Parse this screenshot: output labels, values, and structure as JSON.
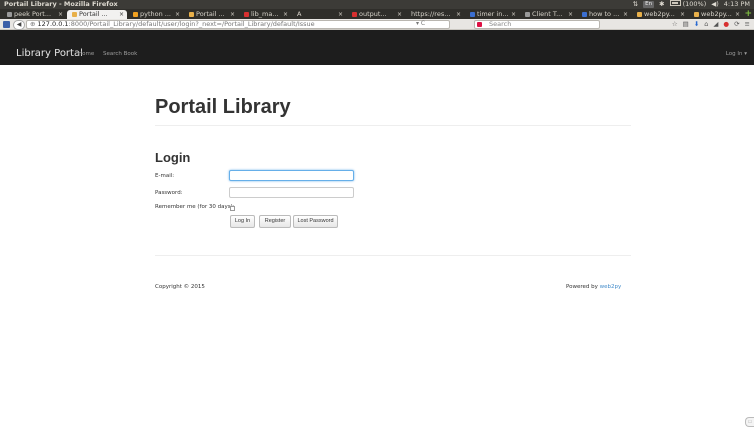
{
  "window": {
    "title": "Portail Library - Mozilla Firefox",
    "tray": {
      "keyboard": "En",
      "battery": "(100%)",
      "volume": "◀)",
      "time": "4:13 PM"
    }
  },
  "tabs": [
    {
      "label": "peek Port...",
      "icon_color": "#9a9a9a",
      "active": false
    },
    {
      "label": "Portail ...",
      "icon_color": "#e8b04a",
      "active": true
    },
    {
      "label": "python ...",
      "icon_color": "#f0a020",
      "active": false
    },
    {
      "label": "Portail ...",
      "icon_color": "#e8b04a",
      "active": false
    },
    {
      "label": "lib_ma...",
      "icon_color": "#d83030",
      "active": false
    },
    {
      "label": "A",
      "icon_color": "#cccccc",
      "active": false
    },
    {
      "label": "output...",
      "icon_color": "#d83030",
      "active": false
    },
    {
      "label": "https://res...",
      "icon_color": "#cccccc",
      "active": false
    },
    {
      "label": "timer in...",
      "icon_color": "#3b6fd1",
      "active": false
    },
    {
      "label": "Client T...",
      "icon_color": "#999999",
      "active": false
    },
    {
      "label": "how to ...",
      "icon_color": "#3b6fd1",
      "active": false
    },
    {
      "label": "web2py...",
      "icon_color": "#e8b04a",
      "active": false
    },
    {
      "label": "web2py...",
      "icon_color": "#e8b04a",
      "active": false
    }
  ],
  "toolbar": {
    "url_host": "127.0.0.1",
    "url_rest": ":8000/Portail_Library/default/user/login?_next=/Portail_Library/default/Issue",
    "search_placeholder": "Search"
  },
  "site": {
    "brand": "Library Portal",
    "nav_home": "Home",
    "nav_search": "Search Book",
    "login_menu": "Log In ▾"
  },
  "page": {
    "title": "Portail Library",
    "form_title": "Login",
    "email_label": "E-mail:",
    "email_value": "",
    "password_label": "Password:",
    "password_value": "",
    "remember_label": "Remember me (for 30 days):",
    "login_button": "Log In",
    "register_button": "Register",
    "lost_password_button": "Lost Password",
    "copyright": "Copyright © 2015",
    "powered_by": "Powered by",
    "powered_link": "web2py"
  },
  "colors": {
    "site_navbar": "#1d1d1d",
    "link": "#428bca",
    "focus_border": "#66afe9"
  }
}
